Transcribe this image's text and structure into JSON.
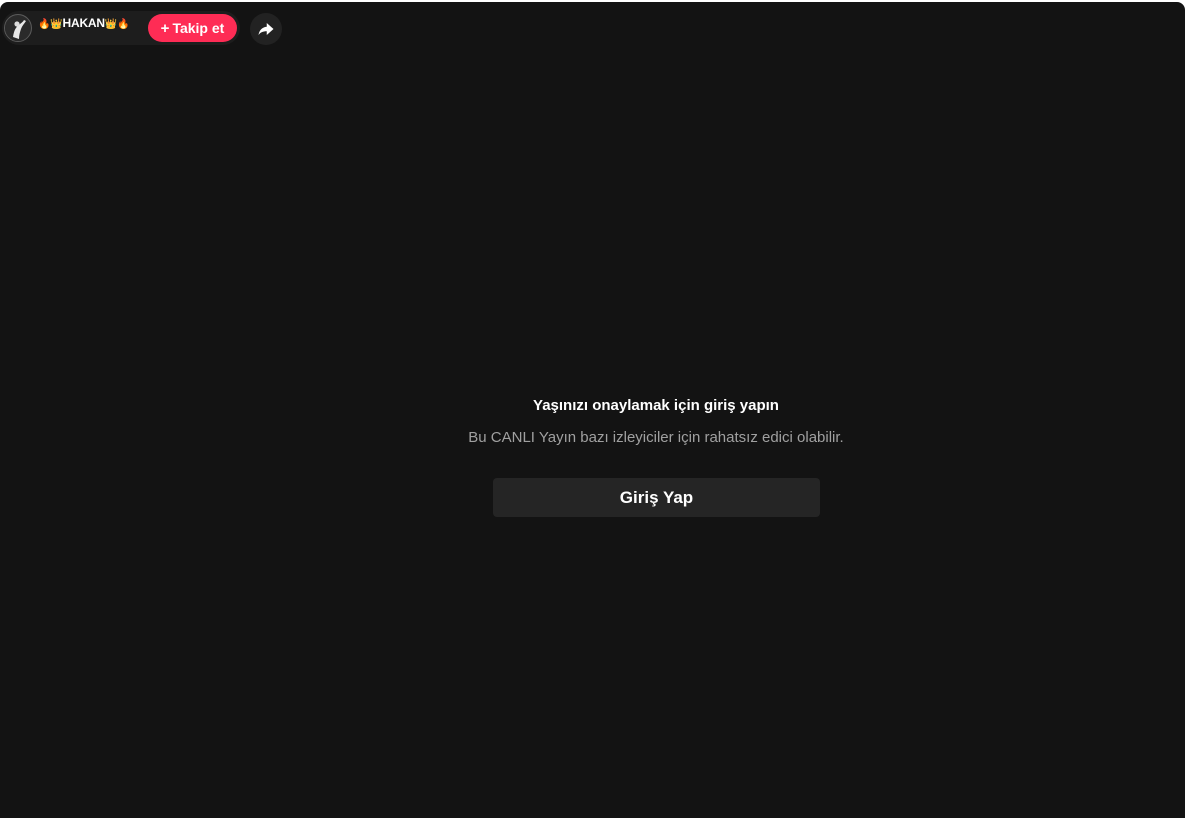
{
  "header": {
    "host_name": "HAKAN",
    "host_name_prefix_emoji": "🔥👑",
    "host_name_suffix_emoji": "👑🔥",
    "follow_plus": "+",
    "follow_label": "Takip et",
    "share_icon": "share-arrow-icon",
    "avatar_icon": "avatar"
  },
  "gate": {
    "title": "Yaşınızı onaylamak için giriş yapın",
    "subtitle": "Bu CANLI Yayın bazı izleyiciler için rahatsız edici olabilir.",
    "login_label": "Giriş Yap"
  },
  "colors": {
    "background": "#131313",
    "accent": "#fe2c55",
    "button_bg": "#252525",
    "subtitle_text": "#a0a0a0"
  }
}
